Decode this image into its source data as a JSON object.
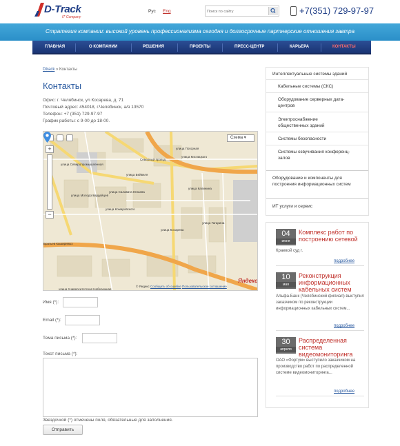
{
  "header": {
    "logo_text": "D-Track",
    "logo_sub": "IT Company",
    "lang_ru": "Рус",
    "lang_en": "Eng",
    "search_placeholder": "Поиск по сайту",
    "phone": "+7(351) 729-97-97"
  },
  "banner": {
    "text": "Стратегия компании: высокий уровень профессионализма сегодня и долгосрочные партнерские отношения завтра"
  },
  "nav": {
    "items": [
      {
        "label": "Главная"
      },
      {
        "label": "О компании"
      },
      {
        "label": "Решения"
      },
      {
        "label": "Проекты"
      },
      {
        "label": "Пресс-центр"
      },
      {
        "label": "Карьера"
      },
      {
        "label": "Контакты"
      }
    ],
    "active": "Контакты"
  },
  "breadcrumb": {
    "home": "Dtrack",
    "sep": "»",
    "current": "Контакты"
  },
  "page": {
    "title": "Контакты",
    "office": "Офис: г. Челябинск, ул Косарева, д. 71",
    "postal": "Почтовый адрес: 454018, г.Челябинск, а/я 13570",
    "phone": "Телефон: +7 (351) 729-97-97",
    "hours": "График работы: с 9-00 до 18-00."
  },
  "map": {
    "type_label": "Схема ▾",
    "zoom_plus": "+",
    "zoom_minus": "−",
    "footer_copyright": "© Яндекс",
    "footer_report": "Сообщить об ошибке",
    "footer_terms": "Пользовательское соглашение",
    "logo": "Яндекс",
    "streets": {
      "s1": "улица Погорная",
      "s2": "улица Кислицкого",
      "s3": "улица Бейвеля",
      "s4": "улица Косарева",
      "s5": "Братьев Кашириных",
      "s6": "улица Университетская Набережная",
      "s7": "улица Северопромышленная",
      "s8": "улица Молодогвардейцев",
      "s9": "улица Комаровского",
      "s10": "Северный проезд",
      "s11": "улица Салавата Юлаева",
      "s12": "улица Калинина",
      "s13": "улица Гагарина"
    }
  },
  "form": {
    "name_label": "Имя (*):",
    "email_label": "Email (*):",
    "subject_label": "Тема письма (*):",
    "message_label": "Текст письма (*):",
    "required_note": "Звездочкой (*) отмечены поля, обязательные для заполнения.",
    "submit": "Отправить"
  },
  "sidebar": {
    "group1_title": "Интеллектуальные системы зданий",
    "group1_items": [
      {
        "label": "Кабельные системы (СКС)"
      },
      {
        "label": "Оборудование серверных дата-центров"
      },
      {
        "label": "Электроснабжение общественных зданий"
      },
      {
        "label": "Системы безопасности"
      },
      {
        "label": "Системы озвучивания конференц-залов"
      }
    ],
    "group2_title": "Оборудование и компоненты для построения информационных систем",
    "group3_title": "ИТ услуги и сервис"
  },
  "news": [
    {
      "day": "04",
      "month": "июня",
      "title": "Комплекс работ по построению сетевой",
      "text": "Краевой суд г.",
      "more": "подробнее"
    },
    {
      "day": "10",
      "month": "мая",
      "title": "Реконструкция информационных кабельных систем",
      "text": "Альфа-Банк (Челябинский филиал) выступил заказчиком по реконструкции информационных кабельных систем...",
      "more": "подробнее"
    },
    {
      "day": "30",
      "month": "апреля",
      "title": "Распределенная система видеомониторинга",
      "text": "ОАО «Фортум» выступило заказчиком на производство работ по распределенной системе видеомониторинга...",
      "more": "подробнее"
    }
  ],
  "colors": {
    "brand_blue": "#1e3d86",
    "banner_blue": "#2b8fc8",
    "accent_red": "#c0302a"
  }
}
